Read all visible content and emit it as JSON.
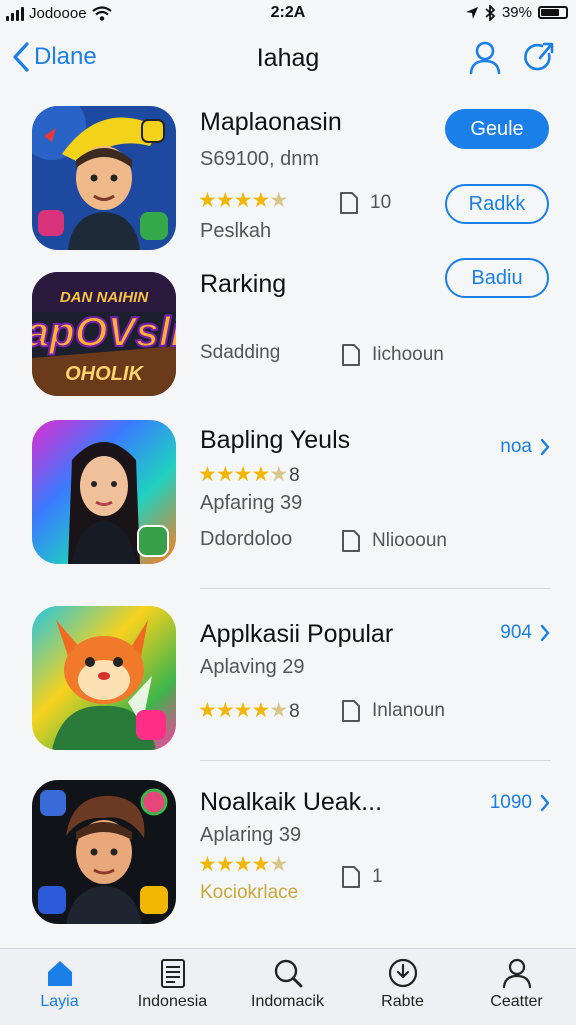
{
  "status_bar": {
    "carrier": "Jodoooe",
    "time": "2:2A",
    "battery": "39%"
  },
  "nav": {
    "back_label": "Dlane",
    "title": "Iahag",
    "icons": [
      "person-icon",
      "refresh-icon"
    ]
  },
  "apps": [
    {
      "name": "Maplaonasin",
      "subtitle": "S69100, dnm",
      "rating_stars": 4,
      "detail": "Peslkah",
      "meta_text": "10",
      "button_label": "Geule",
      "secondary_button_label": "Radkk"
    },
    {
      "name": "Rarking",
      "detail": "Sdadding",
      "meta_text": "Iichooun",
      "button_label": "Badiu",
      "icon_text_top": "DAN NAIHIN",
      "icon_text_main": "apOVsli",
      "icon_text_bottom": "OHOLIK"
    },
    {
      "name": "Bapling Yeuls",
      "subtitle": "Apfaring 39",
      "rating_stars": 4,
      "rating_text": "8",
      "detail": "Ddordoloo",
      "meta_text": "Nlioooun",
      "count": "noa"
    },
    {
      "name": "Applkasii Popular",
      "subtitle": "Aplaving 29",
      "rating_stars": 4,
      "rating_text": "8",
      "meta_text": "Inlanoun",
      "count": "904"
    },
    {
      "name": "Noalkaik Ueak...",
      "subtitle": "Aplaring 39",
      "rating_stars": 4,
      "detail": "Kociokrlace",
      "meta_text": "1",
      "count": "1090"
    }
  ],
  "tabs": [
    {
      "label": "Layia",
      "icon": "home-icon",
      "active": true
    },
    {
      "label": "Indonesia",
      "icon": "document-icon",
      "active": false
    },
    {
      "label": "Indomacik",
      "icon": "search-icon",
      "active": false
    },
    {
      "label": "Rabte",
      "icon": "download-icon",
      "active": false
    },
    {
      "label": "Ceatter",
      "icon": "person-icon",
      "active": false
    }
  ],
  "colors": {
    "accent": "#1a7fe8",
    "star": "#f2b705",
    "background": "#f5f6f8"
  }
}
